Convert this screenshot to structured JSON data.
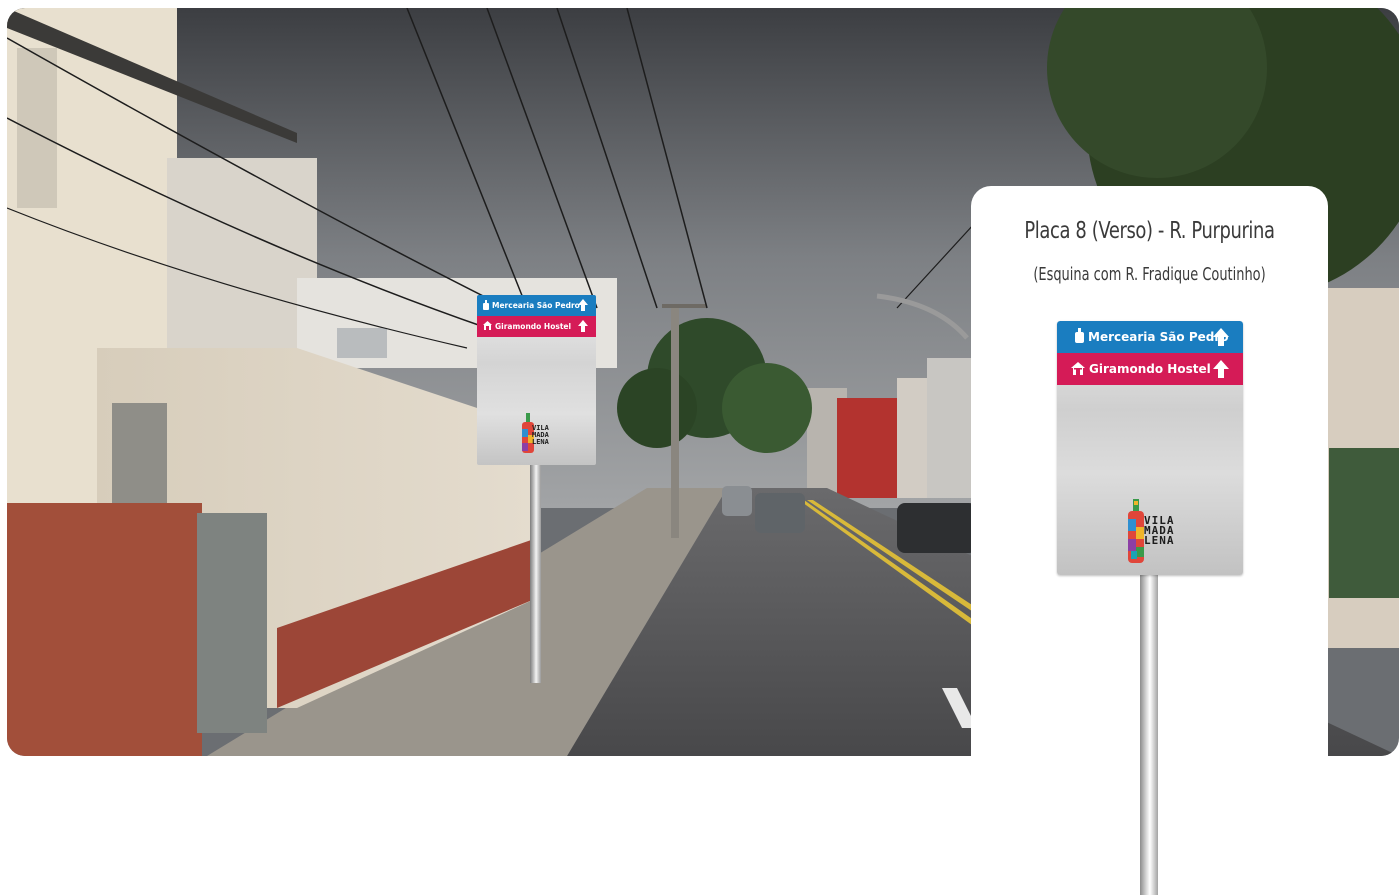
{
  "panel": {
    "title": "Placa 8 (Verso) - R. Purpurina",
    "subtitle": "(Esquina com R. Fradique Coutinho)"
  },
  "sign": {
    "row1_label": "Mercearia São Pedro",
    "row2_label": "Giramondo Hostel",
    "logo_text": "VILA MADA LENA",
    "colors": {
      "blue": "#1a7dc0",
      "red": "#d51b57"
    }
  },
  "icons": {
    "row1_icon": "bottle-icon",
    "row2_icon": "house-icon",
    "arrow": "arrow-up-icon"
  }
}
